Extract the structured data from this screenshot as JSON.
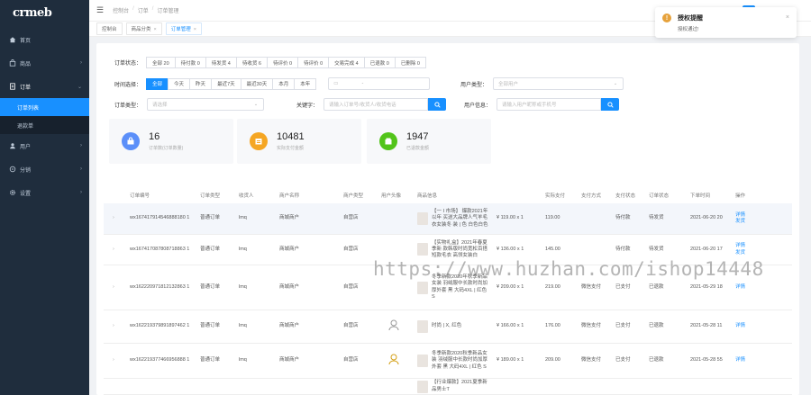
{
  "logo": "crmeb",
  "sidebar": {
    "items": [
      {
        "label": "首页",
        "icon": "home-icon"
      },
      {
        "label": "商品",
        "icon": "goods-icon",
        "arrow": "›"
      },
      {
        "label": "订单",
        "icon": "order-icon",
        "arrow": "⌄"
      },
      {
        "label": "用户",
        "icon": "user-icon",
        "arrow": "›"
      },
      {
        "label": "分销",
        "icon": "distribution-icon",
        "arrow": "›"
      },
      {
        "label": "设置",
        "icon": "settings-icon",
        "arrow": "›"
      }
    ],
    "sub_items": [
      "订单列表",
      "退款单"
    ]
  },
  "header": {
    "crumb": [
      "控制台",
      "订单",
      "订单管理"
    ]
  },
  "tags": [
    {
      "label": "控制台"
    },
    {
      "label": "商品分类",
      "close": "×"
    },
    {
      "label": "订单管理",
      "close": "×"
    }
  ],
  "filters": {
    "status_label": "订单状态：",
    "status": [
      "全部 20",
      "待付款 0",
      "待发货 4",
      "待收货 6",
      "待评价 0",
      "待评价 0",
      "交易完成 4",
      "已退款 0",
      "已删除 0"
    ],
    "time_label": "时间选择：",
    "times": [
      "全部",
      "今天",
      "昨天",
      "最近7天",
      "最近30天",
      "本月",
      "本年"
    ],
    "date_placeholder": "-",
    "user_type_label": "用户类型：",
    "user_type_placeholder": "全部用户",
    "order_type_label": "订单类型：",
    "order_type_placeholder": "请选择",
    "keyword_label": "关键字：",
    "keyword_placeholder": "请输入订单号/收货人/收货电话",
    "user_search_label": "用户信息：",
    "user_search_placeholder": "请输入用户昵称或手机号"
  },
  "stats": [
    {
      "value": "16",
      "label": "订单数(订单数量)",
      "color": "#5b8ff9"
    },
    {
      "value": "10481",
      "label": "实际支付金额",
      "color": "#f5a623"
    },
    {
      "value": "1947",
      "label": "已退款金额",
      "color": "#52c41a"
    }
  ],
  "table": {
    "headers": [
      "订单编号",
      "订单类型",
      "收货人",
      "商户名称",
      "商户类型",
      "用户头像",
      "商品信息",
      "实际支付",
      "支付方式",
      "支付状态",
      "订单状态",
      "下单时间",
      "操作"
    ],
    "rows": [
      {
        "no": "wx167417914546888180 1",
        "type": "普通订单",
        "name": "lmq",
        "merchant": "商城商户",
        "mtype": "自营店",
        "product": "【一 I 市场】 爆款2021年以年 买送大品牌人气羊毛衣女装冬 装 | 色 白色白色",
        "price": "¥ 119.00 x 1",
        "paid": "119.00",
        "pay": "",
        "paystat": "待付款",
        "status": "待发货",
        "time": "2021-06-20 20",
        "ops": [
          "详情",
          "发货"
        ]
      },
      {
        "no": "wx167417087808718863 1",
        "type": "普通订单",
        "name": "lmq",
        "merchant": "商城商户",
        "mtype": "自营店",
        "product": "【实物礼盒】2021年春夏季新 款韩版时尚宽松百搭短款毛衣 高领女装白",
        "price": "¥ 136.00 x 1",
        "paid": "145.00",
        "pay": "",
        "paystat": "待付款",
        "status": "待发货",
        "time": "2021-06-20 17",
        "ops": [
          "详情",
          "发货"
        ]
      },
      {
        "no": "wx162220971812132863 1",
        "type": "普通订单",
        "name": "lmq",
        "merchant": "商城商户",
        "mtype": "自营店",
        "product": "冬季新款2020年秋季新品女装 羽绒服中长款时尚加厚外套 黑 大码4XL | 红色 S",
        "price": "¥ 209.00 x 1",
        "paid": "219.00",
        "pay": "微信支付",
        "paystat": "已支付",
        "status": "已退款",
        "time": "2021-05-29 18",
        "ops": [
          "详情"
        ]
      },
      {
        "no": "wx162219379891897462 1",
        "type": "普通订单",
        "name": "lmq",
        "merchant": "商城商户",
        "mtype": "自营店",
        "product": "时尚 | X, 红色",
        "price": "¥ 166.00 x 1",
        "paid": "176.00",
        "pay": "微信支付",
        "paystat": "已支付",
        "status": "已退款",
        "time": "2021-05-28 11",
        "ops": [
          "详情"
        ]
      },
      {
        "no": "wx162219377466956888 1",
        "type": "普通订单",
        "name": "lmq",
        "merchant": "商城商户",
        "mtype": "自营店",
        "product": "冬季新款2020秋季新品女装 羽绒服中长款时尚加厚外套 黑 大码4XL | 红色 S",
        "price": "¥ 189.00 x 1",
        "paid": "209.00",
        "pay": "微信支付",
        "paystat": "已支付",
        "status": "已退款",
        "time": "2021-05-28 55",
        "ops": [
          "详情"
        ]
      },
      {
        "no": "",
        "type": "",
        "name": "",
        "merchant": "",
        "mtype": "",
        "product": "【行业爆款】2021夏季新品男士T",
        "price": "",
        "paid": "",
        "pay": "",
        "paystat": "",
        "status": "",
        "time": "",
        "ops": []
      }
    ]
  },
  "notice": {
    "title": "授权提醒",
    "message": "授权通过!",
    "close": "×"
  },
  "watermark": "https://www.huzhan.com/ishop14448"
}
